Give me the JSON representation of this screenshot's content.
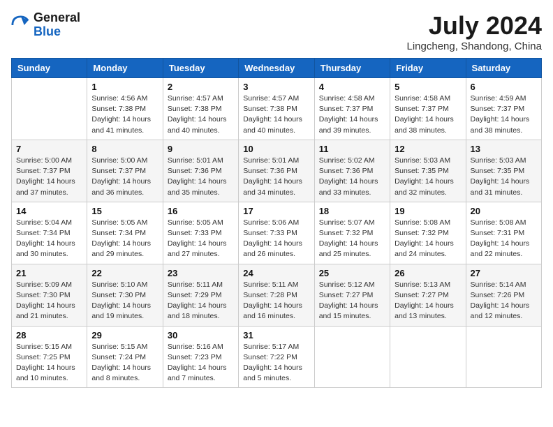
{
  "header": {
    "logo_general": "General",
    "logo_blue": "Blue",
    "month_year": "July 2024",
    "location": "Lingcheng, Shandong, China"
  },
  "weekdays": [
    "Sunday",
    "Monday",
    "Tuesday",
    "Wednesday",
    "Thursday",
    "Friday",
    "Saturday"
  ],
  "weeks": [
    [
      {
        "day": "",
        "info": ""
      },
      {
        "day": "1",
        "info": "Sunrise: 4:56 AM\nSunset: 7:38 PM\nDaylight: 14 hours\nand 41 minutes."
      },
      {
        "day": "2",
        "info": "Sunrise: 4:57 AM\nSunset: 7:38 PM\nDaylight: 14 hours\nand 40 minutes."
      },
      {
        "day": "3",
        "info": "Sunrise: 4:57 AM\nSunset: 7:38 PM\nDaylight: 14 hours\nand 40 minutes."
      },
      {
        "day": "4",
        "info": "Sunrise: 4:58 AM\nSunset: 7:37 PM\nDaylight: 14 hours\nand 39 minutes."
      },
      {
        "day": "5",
        "info": "Sunrise: 4:58 AM\nSunset: 7:37 PM\nDaylight: 14 hours\nand 38 minutes."
      },
      {
        "day": "6",
        "info": "Sunrise: 4:59 AM\nSunset: 7:37 PM\nDaylight: 14 hours\nand 38 minutes."
      }
    ],
    [
      {
        "day": "7",
        "info": "Sunrise: 5:00 AM\nSunset: 7:37 PM\nDaylight: 14 hours\nand 37 minutes."
      },
      {
        "day": "8",
        "info": "Sunrise: 5:00 AM\nSunset: 7:37 PM\nDaylight: 14 hours\nand 36 minutes."
      },
      {
        "day": "9",
        "info": "Sunrise: 5:01 AM\nSunset: 7:36 PM\nDaylight: 14 hours\nand 35 minutes."
      },
      {
        "day": "10",
        "info": "Sunrise: 5:01 AM\nSunset: 7:36 PM\nDaylight: 14 hours\nand 34 minutes."
      },
      {
        "day": "11",
        "info": "Sunrise: 5:02 AM\nSunset: 7:36 PM\nDaylight: 14 hours\nand 33 minutes."
      },
      {
        "day": "12",
        "info": "Sunrise: 5:03 AM\nSunset: 7:35 PM\nDaylight: 14 hours\nand 32 minutes."
      },
      {
        "day": "13",
        "info": "Sunrise: 5:03 AM\nSunset: 7:35 PM\nDaylight: 14 hours\nand 31 minutes."
      }
    ],
    [
      {
        "day": "14",
        "info": "Sunrise: 5:04 AM\nSunset: 7:34 PM\nDaylight: 14 hours\nand 30 minutes."
      },
      {
        "day": "15",
        "info": "Sunrise: 5:05 AM\nSunset: 7:34 PM\nDaylight: 14 hours\nand 29 minutes."
      },
      {
        "day": "16",
        "info": "Sunrise: 5:05 AM\nSunset: 7:33 PM\nDaylight: 14 hours\nand 27 minutes."
      },
      {
        "day": "17",
        "info": "Sunrise: 5:06 AM\nSunset: 7:33 PM\nDaylight: 14 hours\nand 26 minutes."
      },
      {
        "day": "18",
        "info": "Sunrise: 5:07 AM\nSunset: 7:32 PM\nDaylight: 14 hours\nand 25 minutes."
      },
      {
        "day": "19",
        "info": "Sunrise: 5:08 AM\nSunset: 7:32 PM\nDaylight: 14 hours\nand 24 minutes."
      },
      {
        "day": "20",
        "info": "Sunrise: 5:08 AM\nSunset: 7:31 PM\nDaylight: 14 hours\nand 22 minutes."
      }
    ],
    [
      {
        "day": "21",
        "info": "Sunrise: 5:09 AM\nSunset: 7:30 PM\nDaylight: 14 hours\nand 21 minutes."
      },
      {
        "day": "22",
        "info": "Sunrise: 5:10 AM\nSunset: 7:30 PM\nDaylight: 14 hours\nand 19 minutes."
      },
      {
        "day": "23",
        "info": "Sunrise: 5:11 AM\nSunset: 7:29 PM\nDaylight: 14 hours\nand 18 minutes."
      },
      {
        "day": "24",
        "info": "Sunrise: 5:11 AM\nSunset: 7:28 PM\nDaylight: 14 hours\nand 16 minutes."
      },
      {
        "day": "25",
        "info": "Sunrise: 5:12 AM\nSunset: 7:27 PM\nDaylight: 14 hours\nand 15 minutes."
      },
      {
        "day": "26",
        "info": "Sunrise: 5:13 AM\nSunset: 7:27 PM\nDaylight: 14 hours\nand 13 minutes."
      },
      {
        "day": "27",
        "info": "Sunrise: 5:14 AM\nSunset: 7:26 PM\nDaylight: 14 hours\nand 12 minutes."
      }
    ],
    [
      {
        "day": "28",
        "info": "Sunrise: 5:15 AM\nSunset: 7:25 PM\nDaylight: 14 hours\nand 10 minutes."
      },
      {
        "day": "29",
        "info": "Sunrise: 5:15 AM\nSunset: 7:24 PM\nDaylight: 14 hours\nand 8 minutes."
      },
      {
        "day": "30",
        "info": "Sunrise: 5:16 AM\nSunset: 7:23 PM\nDaylight: 14 hours\nand 7 minutes."
      },
      {
        "day": "31",
        "info": "Sunrise: 5:17 AM\nSunset: 7:22 PM\nDaylight: 14 hours\nand 5 minutes."
      },
      {
        "day": "",
        "info": ""
      },
      {
        "day": "",
        "info": ""
      },
      {
        "day": "",
        "info": ""
      }
    ]
  ]
}
